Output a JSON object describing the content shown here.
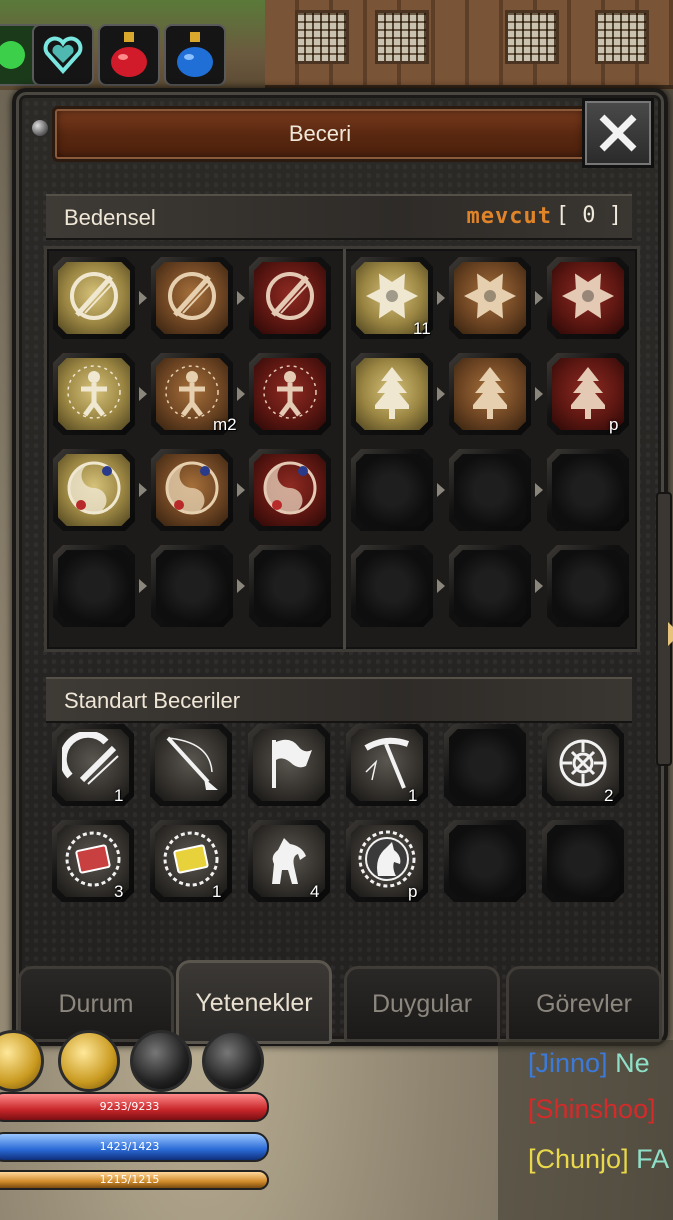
{
  "window": {
    "title": "Beceri"
  },
  "skills_section": {
    "label": "Bedensel",
    "points_label": "mevcut",
    "points_value": "[ 0 ]"
  },
  "skill_rows": [
    [
      {
        "icon": "blade-stance-icon",
        "tone": "gold",
        "level": ""
      },
      {
        "icon": "blade-stance-icon",
        "tone": "bronze",
        "level": ""
      },
      {
        "icon": "blade-stance-icon",
        "tone": "red",
        "level": ""
      },
      {
        "icon": "starburst-icon",
        "tone": "gold",
        "level": "11"
      },
      {
        "icon": "starburst-icon",
        "tone": "bronze",
        "level": ""
      },
      {
        "icon": "starburst-icon",
        "tone": "red",
        "level": ""
      }
    ],
    [
      {
        "icon": "aura-figure-icon",
        "tone": "gold",
        "level": ""
      },
      {
        "icon": "aura-figure-icon",
        "tone": "bronze",
        "level": "m2"
      },
      {
        "icon": "aura-figure-icon",
        "tone": "red",
        "level": ""
      },
      {
        "icon": "pine-sword-icon",
        "tone": "gold",
        "level": ""
      },
      {
        "icon": "pine-sword-icon",
        "tone": "bronze",
        "level": ""
      },
      {
        "icon": "pine-sword-icon",
        "tone": "red",
        "level": "p"
      }
    ],
    [
      {
        "icon": "yin-yang-icon",
        "tone": "gold",
        "level": ""
      },
      {
        "icon": "yin-yang-icon",
        "tone": "bronze",
        "level": ""
      },
      {
        "icon": "yin-yang-icon",
        "tone": "red",
        "level": ""
      },
      {
        "icon": "empty",
        "tone": "empty",
        "level": ""
      },
      {
        "icon": "empty",
        "tone": "empty",
        "level": ""
      },
      {
        "icon": "empty",
        "tone": "empty",
        "level": ""
      }
    ],
    [
      {
        "icon": "empty",
        "tone": "empty",
        "level": ""
      },
      {
        "icon": "empty",
        "tone": "empty",
        "level": ""
      },
      {
        "icon": "empty",
        "tone": "empty",
        "level": ""
      },
      {
        "icon": "empty",
        "tone": "empty",
        "level": ""
      },
      {
        "icon": "empty",
        "tone": "empty",
        "level": ""
      },
      {
        "icon": "empty",
        "tone": "empty",
        "level": ""
      }
    ]
  ],
  "standard_section": {
    "label": "Standart Beceriler"
  },
  "standard_rows": [
    [
      {
        "icon": "strike-icon",
        "level": "1"
      },
      {
        "icon": "fishing-rod-icon",
        "level": ""
      },
      {
        "icon": "flag-icon",
        "level": ""
      },
      {
        "icon": "pickaxe-icon",
        "level": "1"
      },
      {
        "icon": "empty",
        "level": ""
      },
      {
        "icon": "knot-icon",
        "level": "2"
      }
    ],
    [
      {
        "icon": "red-book-icon",
        "level": "3"
      },
      {
        "icon": "yellow-book-icon",
        "level": "1"
      },
      {
        "icon": "horse-icon",
        "level": "4"
      },
      {
        "icon": "horse-badge-icon",
        "level": "p"
      },
      {
        "icon": "empty",
        "level": ""
      },
      {
        "icon": "empty",
        "level": ""
      }
    ]
  ],
  "tabs": [
    {
      "label": "Durum",
      "active": false
    },
    {
      "label": "Yetenekler",
      "active": true
    },
    {
      "label": "Duygular",
      "active": false
    },
    {
      "label": "Görevler",
      "active": false
    }
  ],
  "hud": {
    "hp": "9233/9233",
    "mp": "1423/1423",
    "stamina": "1215/1215"
  },
  "chat": [
    {
      "name": "[Jinno]",
      "text": " Ne",
      "color": "#3b7ad8",
      "text_color": "#8fe0c8"
    },
    {
      "name": "[Shinshoo]",
      "text": "",
      "color": "#d42a2a",
      "text_color": "#d42a2a"
    },
    {
      "name": "[Chunjo]",
      "text": " FA",
      "color": "#e8d84a",
      "text_color": "#8fe0c8"
    }
  ],
  "colors": {
    "gold": "#b8a35a",
    "bronze": "#8a5a2e",
    "red": "#7a1e1a",
    "accent_orange": "#e0842a"
  }
}
